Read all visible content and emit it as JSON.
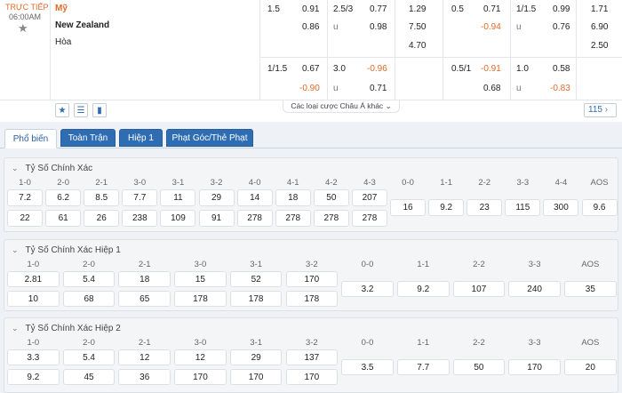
{
  "match": {
    "status": "TRỰC TIẾP",
    "time": "06:00AM",
    "home": "Mỹ",
    "away": "New Zealand",
    "draw": "Hòa"
  },
  "odds_rows": [
    {
      "h1": "1.5",
      "h1v": "0.91",
      "h2": "2.5/3",
      "h2v": "0.77",
      "x": "1.29",
      "h3": "0.5",
      "h3v": "0.71",
      "h4": "1/1.5",
      "h4v": "0.99",
      "x2": "1.71"
    },
    {
      "h1": "",
      "h1v": "0.86",
      "h2": "u",
      "h2v": "0.98",
      "x": "7.50",
      "h3": "",
      "h3v": "-0.94",
      "h4": "u",
      "h4v": "0.76",
      "x2": "6.90"
    },
    {
      "h1": "",
      "h1v": "",
      "h2": "",
      "h2v": "",
      "x": "4.70",
      "h3": "",
      "h3v": "",
      "h4": "",
      "h4v": "",
      "x2": "2.50"
    },
    {
      "h1": "1/1.5",
      "h1v": "0.67",
      "h2": "3.0",
      "h2v": "-0.96",
      "x": "",
      "h3": "0.5/1",
      "h3v": "-0.91",
      "h4": "1.0",
      "h4v": "0.58",
      "x2": ""
    },
    {
      "h1": "",
      "h1v": "-0.90",
      "h2": "u",
      "h2v": "0.71",
      "x": "",
      "h3": "",
      "h3v": "0.68",
      "h4": "u",
      "h4v": "-0.83",
      "x2": ""
    }
  ],
  "more_bets": "Các loại cược Châu Á khác",
  "more_count": "115",
  "tabs": [
    "Phổ biến",
    "Toàn Trận",
    "Hiệp 1",
    "Phạt Góc/Thẻ Phạt"
  ],
  "sections": [
    {
      "title": "Tỷ Số Chính Xác",
      "labels": [
        "1-0",
        "2-0",
        "2-1",
        "3-0",
        "3-1",
        "3-2",
        "4-0",
        "4-1",
        "4-2",
        "4-3",
        "0-0",
        "1-1",
        "2-2",
        "3-3",
        "4-4",
        "AOS"
      ],
      "row1": [
        "7.2",
        "6.2",
        "8.5",
        "7.7",
        "11",
        "29",
        "14",
        "18",
        "50",
        "207"
      ],
      "row2": [
        "22",
        "61",
        "26",
        "238",
        "109",
        "91",
        "278",
        "278",
        "278",
        "278"
      ],
      "mid": [
        "16",
        "9.2",
        "23",
        "115",
        "300",
        "9.6"
      ]
    },
    {
      "title": "Tỷ Số Chính Xác Hiệp 1",
      "labels": [
        "1-0",
        "2-0",
        "2-1",
        "3-0",
        "3-1",
        "3-2",
        "0-0",
        "1-1",
        "2-2",
        "3-3",
        "AOS"
      ],
      "row1": [
        "2.81",
        "5.4",
        "18",
        "15",
        "52",
        "170"
      ],
      "row2": [
        "10",
        "68",
        "65",
        "178",
        "178",
        "178"
      ],
      "mid": [
        "3.2",
        "9.2",
        "107",
        "240",
        "35"
      ]
    },
    {
      "title": "Tỷ Số Chính Xác Hiệp 2",
      "labels": [
        "1-0",
        "2-0",
        "2-1",
        "3-0",
        "3-1",
        "3-2",
        "0-0",
        "1-1",
        "2-2",
        "3-3",
        "AOS"
      ],
      "row1": [
        "3.3",
        "5.4",
        "12",
        "12",
        "29",
        "137"
      ],
      "row2": [
        "9.2",
        "45",
        "36",
        "170",
        "170",
        "170"
      ],
      "mid": [
        "3.5",
        "7.7",
        "50",
        "170",
        "20"
      ]
    }
  ]
}
